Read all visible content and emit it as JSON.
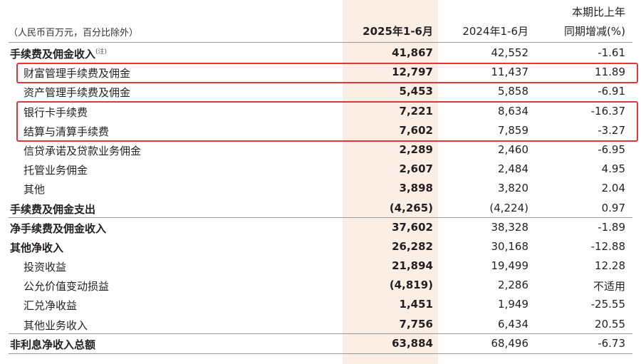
{
  "header": {
    "unit_note": "（人民币百万元，百分比除外）",
    "col_current": "2025年1-6月",
    "col_previous": "2024年1-6月",
    "col_change_line1": "本期比上年",
    "col_change_line2": "同期增减(%)"
  },
  "rows": [
    {
      "label": "手续费及佣金收入",
      "note": "(注)",
      "current": "41,867",
      "previous": "42,552",
      "change": "-1.61"
    },
    {
      "label": "财富管理手续费及佣金",
      "current": "12,797",
      "previous": "11,437",
      "change": "11.89"
    },
    {
      "label": "资产管理手续费及佣金",
      "current": "5,453",
      "previous": "5,858",
      "change": "-6.91"
    },
    {
      "label": "银行卡手续费",
      "current": "7,221",
      "previous": "8,634",
      "change": "-16.37"
    },
    {
      "label": "结算与清算手续费",
      "current": "7,602",
      "previous": "7,859",
      "change": "-3.27"
    },
    {
      "label": "信贷承诺及贷款业务佣金",
      "current": "2,289",
      "previous": "2,460",
      "change": "-6.95"
    },
    {
      "label": "托管业务佣金",
      "current": "2,607",
      "previous": "2,484",
      "change": "4.95"
    },
    {
      "label": "其他",
      "current": "3,898",
      "previous": "3,820",
      "change": "2.04"
    },
    {
      "label": "手续费及佣金支出",
      "current": "(4,265)",
      "previous": "(4,224)",
      "change": "0.97"
    },
    {
      "label": "净手续费及佣金收入",
      "current": "37,602",
      "previous": "38,328",
      "change": "-1.89"
    },
    {
      "label": "其他净收入",
      "current": "26,282",
      "previous": "30,168",
      "change": "-12.88"
    },
    {
      "label": "投资收益",
      "current": "21,894",
      "previous": "19,499",
      "change": "12.28"
    },
    {
      "label": "公允价值变动损益",
      "current": "(4,819)",
      "previous": "2,286",
      "change": "不适用"
    },
    {
      "label": "汇兑净收益",
      "current": "1,451",
      "previous": "1,949",
      "change": "-25.55"
    },
    {
      "label": "其他业务收入",
      "current": "7,756",
      "previous": "6,434",
      "change": "20.55"
    },
    {
      "label": "非利息净收入总额",
      "current": "63,884",
      "previous": "68,496",
      "change": "-6.73"
    }
  ],
  "colors": {
    "highlight_column": "#fbeee4",
    "annotation_box": "#e0373b",
    "rule": "#9a9a9a"
  }
}
